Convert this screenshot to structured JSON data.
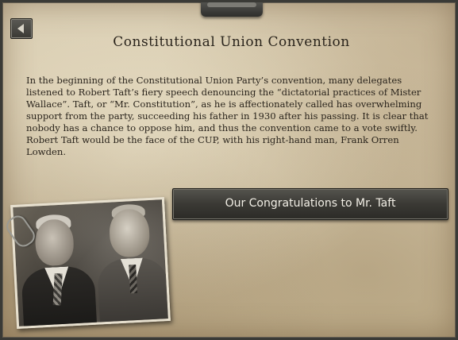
{
  "event": {
    "title": "Constitutional Union Convention",
    "body": "In the beginning of the Constitutional Union Party’s convention, many delegates listened to Robert Taft’s fiery speech denouncing the “dictatorial practices of Mister Wallace”. Taft, or “Mr. Constitution”, as he is affectionately called has overwhelming support from the party, succeeding his father in 1930 after his passing. It is clear that nobody has a chance to oppose him, and thus the convention came to a vote swiftly. Robert Taft would be the face of the CUP, with his right-hand man, Frank Orren Lowden.",
    "option_label": "Our Congratulations to Mr. Taft"
  },
  "icons": {
    "back": "back-arrow-icon",
    "clip": "paper-clip-icon"
  },
  "colors": {
    "parchment": "#d3c5a7",
    "text": "#2a241c",
    "button_bg": "#3a3934",
    "button_text": "#f2efe6"
  }
}
